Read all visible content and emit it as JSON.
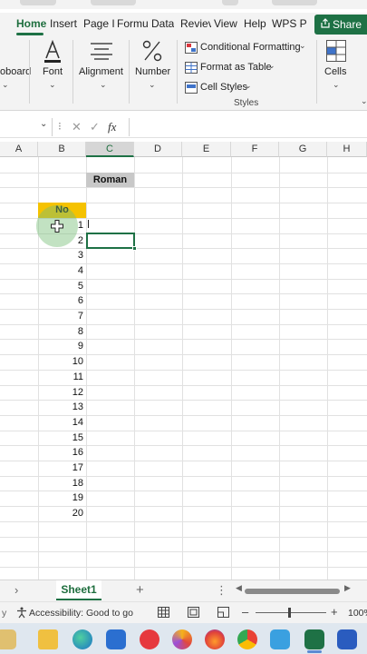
{
  "ribbon": {
    "tabs": [
      {
        "label": "Home",
        "active": true
      },
      {
        "label": "Insert"
      },
      {
        "label": "Page I"
      },
      {
        "label": "Formu"
      },
      {
        "label": "Data"
      },
      {
        "label": "Reviev"
      },
      {
        "label": "View"
      },
      {
        "label": "Help"
      },
      {
        "label": "WPS P"
      }
    ],
    "share_label": "Share",
    "clipboard_label": "oboard",
    "font_label": "Font",
    "alignment_label": "Alignment",
    "number_label": "Number",
    "styles_items": [
      "Conditional Formatting",
      "Format as Table",
      "Cell Styles"
    ],
    "styles_group_label": "Styles",
    "cells_label": "Cells"
  },
  "formula_bar": {
    "fx_label": "fx",
    "cancel_glyph": "✕",
    "enter_glyph": "✓",
    "value": ""
  },
  "grid": {
    "columns": [
      "A",
      "B",
      "C",
      "D",
      "E",
      "F",
      "G",
      "H"
    ],
    "selected_column": "C",
    "no_header": "No",
    "roman_header": "Roman",
    "numbers": [
      "1",
      "2",
      "3",
      "4",
      "5",
      "6",
      "7",
      "8",
      "9",
      "10",
      "11",
      "12",
      "13",
      "14",
      "15",
      "16",
      "17",
      "18",
      "19",
      "20"
    ]
  },
  "sheets": {
    "tabs": [
      "Sheet1"
    ],
    "add_glyph": "+"
  },
  "status": {
    "accessibility": "Accessibility: Good to go",
    "zoom": "100%"
  },
  "taskbar": {
    "icons": [
      "paint-icon",
      "file-explorer-icon",
      "edge-icon",
      "store-icon",
      "wps-icon",
      "ring-app-icon",
      "firefox-icon",
      "chrome-icon",
      "notepad-icon",
      "excel-icon",
      "word-icon"
    ]
  },
  "colors": {
    "accent": "#1e7145",
    "no_header_fill": "#f5c200",
    "roman_header_fill": "#c8c8c8"
  }
}
